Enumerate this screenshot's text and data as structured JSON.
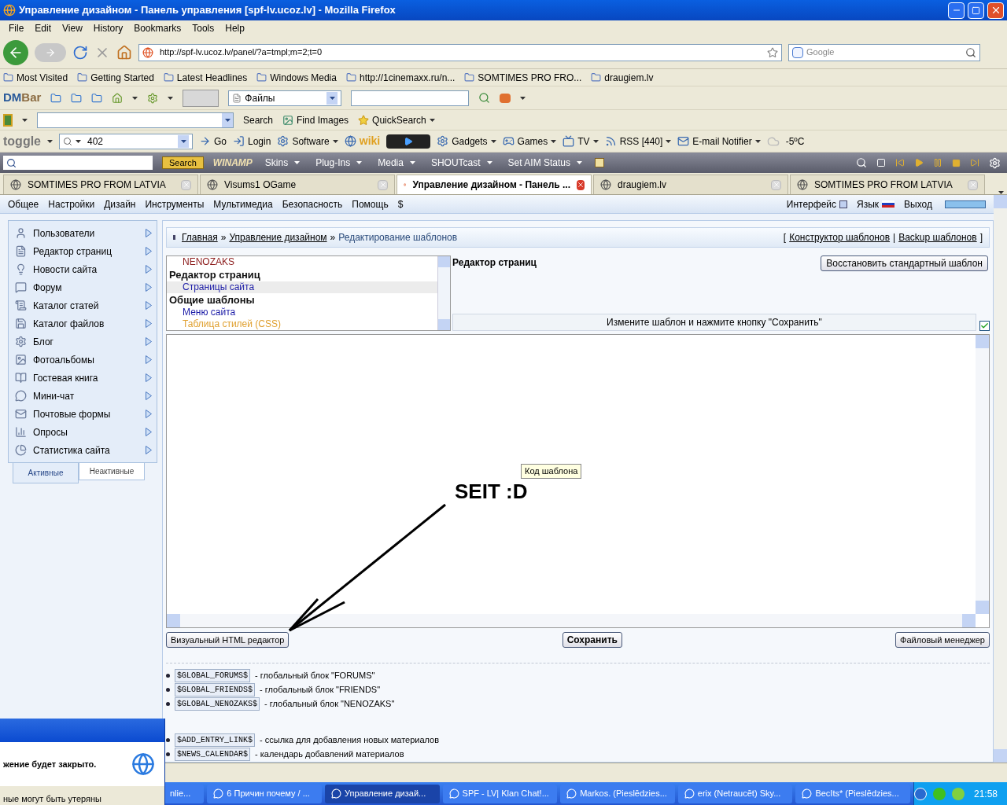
{
  "window": {
    "title": "Управление дизайном - Панель управления [spf-lv.ucoz.lv] - Mozilla Firefox"
  },
  "menu": [
    "File",
    "Edit",
    "View",
    "History",
    "Bookmarks",
    "Tools",
    "Help"
  ],
  "address": {
    "url": "http://spf-lv.ucoz.lv/panel/?a=tmpl;m=2;t=0"
  },
  "search": {
    "placeholder": "Google"
  },
  "bookmarks": [
    "Most Visited",
    "Getting Started",
    "Latest Headlines",
    "Windows Media",
    "http://1cinemaxx.ru/n...",
    "SOMTIMES PRO FRO...",
    "draugiem.lv"
  ],
  "dmbar": {
    "logo_dm": "DM",
    "logo_bar": "Bar",
    "dropdown": "Файлы"
  },
  "search_toolbar": {
    "items": [
      "Search",
      "Find Images",
      "QuickSearch"
    ]
  },
  "toggle_toolbar": {
    "logo": "toggle",
    "query": "402",
    "weather": "-5ºC",
    "items": [
      {
        "label": "Go",
        "dropdown": false
      },
      {
        "label": "Login",
        "dropdown": false
      },
      {
        "label": "Software",
        "dropdown": true
      },
      {
        "label": "wiki",
        "dropdown": false
      },
      {
        "label": "Gadgets",
        "dropdown": true
      },
      {
        "label": "Games",
        "dropdown": true
      },
      {
        "label": "TV",
        "dropdown": true
      },
      {
        "label": "RSS [440]",
        "dropdown": true
      },
      {
        "label": "E-mail Notifier",
        "dropdown": true
      }
    ]
  },
  "winamp_bar": {
    "button": "Search",
    "logo": "WINAMP",
    "menus": [
      "Skins",
      "Plug-Ins",
      "Media",
      "SHOUTcast",
      "Set AIM Status"
    ]
  },
  "tabs": [
    {
      "label": "SOMTIMES PRO FROM LATVIA",
      "selected": false
    },
    {
      "label": "Visums1 OGame",
      "selected": false
    },
    {
      "label": "Управление дизайном - Панель ...",
      "selected": true
    },
    {
      "label": "draugiem.lv",
      "selected": false
    },
    {
      "label": "SOMTIMES PRO FROM LATVIA",
      "selected": false
    }
  ],
  "site_menu": [
    "Общее",
    "Настройки",
    "Дизайн",
    "Инструменты",
    "Мультимедиа",
    "Безопасность",
    "Помощь",
    "$"
  ],
  "site_menu_right": {
    "interface": "Интерфейс",
    "language": "Язык",
    "logout": "Выход"
  },
  "sidebar": {
    "items": [
      "Пользователи",
      "Редактор страниц",
      "Новости сайта",
      "Форум",
      "Каталог статей",
      "Каталог файлов",
      "Блог",
      "Фотоальбомы",
      "Гостевая книга",
      "Мини-чат",
      "Почтовые формы",
      "Опросы",
      "Статистика сайта"
    ],
    "tabs": [
      {
        "label": "Активные",
        "selected": true
      },
      {
        "label": "Неактивные",
        "selected": false
      }
    ]
  },
  "breadcrumb": {
    "items": [
      "Главная",
      "Управление дизайном",
      "Редактирование шаблонов"
    ],
    "separator": "»",
    "links": [
      "Конструктор шаблонов",
      "Backup шаблонов"
    ],
    "open": "[",
    "divider": "|",
    "close": "]"
  },
  "template_list": [
    {
      "kind": "link",
      "label": "NENOZAKS",
      "color": "#8b1a1a",
      "selected": false
    },
    {
      "kind": "heading",
      "label": "Редактор страниц"
    },
    {
      "kind": "link",
      "label": "Страницы сайта",
      "color": "#1a1aa6",
      "selected": true
    },
    {
      "kind": "heading",
      "label": "Общие шаблоны"
    },
    {
      "kind": "link",
      "label": "Меню сайта",
      "color": "#1a1aa6",
      "selected": false
    },
    {
      "kind": "link",
      "label": "Таблица стилей (CSS)",
      "color": "#e0a030",
      "selected": false
    }
  ],
  "editor": {
    "title": "Редактор страниц",
    "restore_button": "Восстановить стандартный шаблон",
    "hint": "Измените шаблон и нажмите кнопку \"Сохранить\"",
    "checked": true,
    "tooltip": "Код шаблона",
    "annotation": "SEIT :D"
  },
  "buttons": [
    "Визуальный HTML редактор",
    "Сохранить",
    "Файловый менеджер"
  ],
  "variables": [
    [
      {
        "code": "$GLOBAL_FORUMS$",
        "desc": "- глобальный блок \"FORUMS\""
      },
      {
        "code": "$GLOBAL_FRIENDS$",
        "desc": "- глобальный блок \"FRIENDS\""
      },
      {
        "code": "$GLOBAL_NENOZAKS$",
        "desc": "- глобальный блок \"NENOZAKS\""
      }
    ],
    [
      {
        "code": "$ADD_ENTRY_LINK$",
        "desc": "- ссылка для добавления новых материалов"
      },
      {
        "code": "$NEWS_CALENDAR$",
        "desc": "- календарь добавлений материалов"
      }
    ]
  ],
  "popup": {
    "message": "жение будет закрыто.",
    "note": "ные могут быть утеряны"
  },
  "taskbar": {
    "items": [
      {
        "label": "nlie...",
        "selected": false
      },
      {
        "label": "6 Причин почему / ...",
        "selected": false
      },
      {
        "label": "Управление дизай...",
        "selected": true
      },
      {
        "label": "SPF - LV| Klan Chat!...",
        "selected": false
      },
      {
        "label": "Markos. (Pieslēdzies...",
        "selected": false
      },
      {
        "label": "erix (Netraucēt) Sky...",
        "selected": false
      },
      {
        "label": "BecIts* (Pieslēdzies...",
        "selected": false
      }
    ],
    "clock": "21:58"
  }
}
